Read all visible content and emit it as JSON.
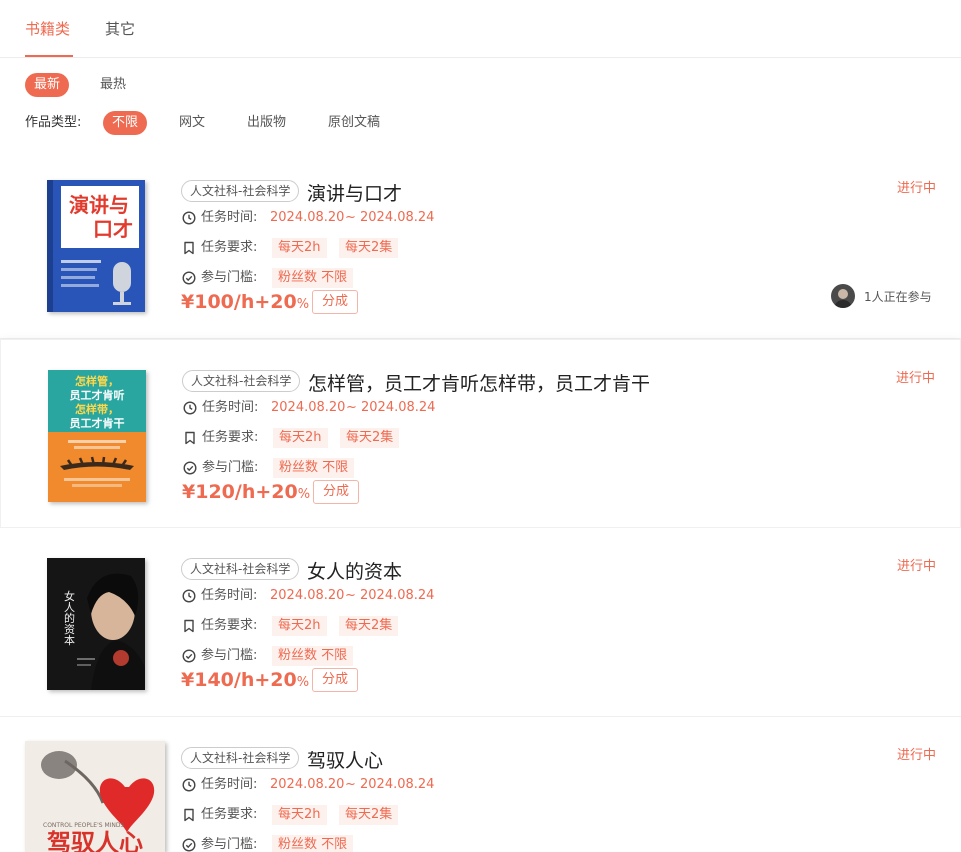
{
  "tabs": [
    {
      "label": "书籍类",
      "active": true
    },
    {
      "label": "其它",
      "active": false
    }
  ],
  "sort": [
    {
      "label": "最新",
      "active": true
    },
    {
      "label": "最热",
      "active": false
    }
  ],
  "filter": {
    "label": "作品类型:",
    "options": [
      {
        "label": "不限",
        "active": true
      },
      {
        "label": "网文",
        "active": false
      },
      {
        "label": "出版物",
        "active": false
      },
      {
        "label": "原创文稿",
        "active": false
      }
    ]
  },
  "labels": {
    "time": "任务时间:",
    "requirement": "任务要求:",
    "threshold": "参与门槛:",
    "share": "分成",
    "tilde": "~"
  },
  "colors": {
    "accent": "#ee6a50",
    "chip_bg": "#fdf1ee"
  },
  "tasks": [
    {
      "category": "人文社科-社会科学",
      "title": "演讲与口才",
      "start": "2024.08.20",
      "end": "2024.08.24",
      "req_hours": "每天2h",
      "req_episodes": "每天2集",
      "threshold": "粉丝数 不限",
      "price": "¥100/h+20",
      "price_pct": "%",
      "status": "进行中",
      "participants": "1人正在参与",
      "cover": {
        "title_a": "演讲与",
        "title_b": "口才"
      }
    },
    {
      "category": "人文社科-社会科学",
      "title": "怎样管，员工才肯听怎样带，员工才肯干",
      "start": "2024.08.20",
      "end": "2024.08.24",
      "req_hours": "每天2h",
      "req_episodes": "每天2集",
      "threshold": "粉丝数 不限",
      "price": "¥120/h+20",
      "price_pct": "%",
      "status": "进行中",
      "cover": {
        "line_1": "怎样管，",
        "line_2": "员工才肯听",
        "line_3": "怎样带，",
        "line_4": "员工才肯干"
      }
    },
    {
      "category": "人文社科-社会科学",
      "title": "女人的资本",
      "start": "2024.08.20",
      "end": "2024.08.24",
      "req_hours": "每天2h",
      "req_episodes": "每天2集",
      "threshold": "粉丝数 不限",
      "price": "¥140/h+20",
      "price_pct": "%",
      "status": "进行中",
      "cover": {
        "title": "女人的资本"
      }
    },
    {
      "category": "人文社科-社会科学",
      "title": "驾驭人心",
      "start": "2024.08.20",
      "end": "2024.08.24",
      "req_hours": "每天2h",
      "req_episodes": "每天2集",
      "threshold": "粉丝数 不限",
      "status": "进行中",
      "cover": {
        "subtitle": "CONTROL PEOPLE'S MINDS",
        "title": "驾驭人心"
      }
    }
  ]
}
